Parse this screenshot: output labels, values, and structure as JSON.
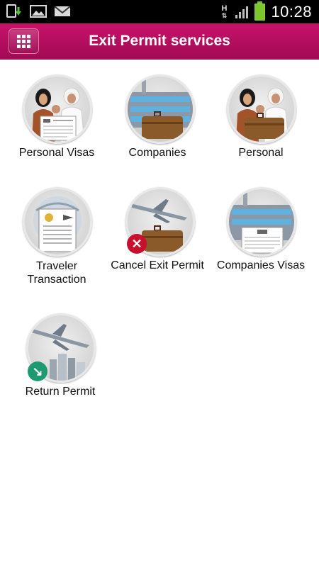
{
  "status_bar": {
    "time": "10:28",
    "network": "H"
  },
  "header": {
    "title": "Exit Permit services",
    "menu_icon": "grid-menu-icon"
  },
  "colors": {
    "accent": "#b30e60",
    "cancel_badge": "#c8102e",
    "return_badge": "#1d9a72"
  },
  "services": [
    {
      "id": "personal-visas",
      "label": "Personal Visas"
    },
    {
      "id": "companies",
      "label": "Companies"
    },
    {
      "id": "personal",
      "label": "Personal"
    },
    {
      "id": "traveler-transaction",
      "label": "Traveler Transaction",
      "label_lines": [
        "Traveler",
        "Transaction"
      ]
    },
    {
      "id": "cancel-exit-permit",
      "label": "Cancel Exit Permit"
    },
    {
      "id": "companies-visas",
      "label": "Companies Visas"
    },
    {
      "id": "return-permit",
      "label": "Return Permit"
    }
  ]
}
